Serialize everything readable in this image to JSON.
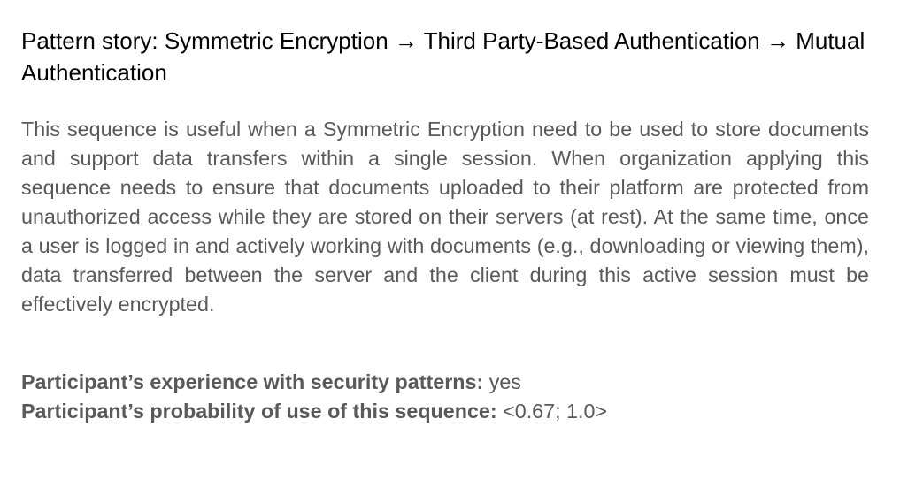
{
  "title": "Pattern story: Symmetric Encryption → Third Party-Based Authentication → Mutual Authentication",
  "paragraph": "This sequence is useful when a Symmetric Encryption need to be used to store documents and support data transfers within a single session. When organization applying this sequence needs to ensure that documents uploaded to their platform are protected from unauthorized access while they are stored on their servers (at rest). At the same time, once a user is logged in and actively working with documents (e.g., downloading or viewing them), data transferred between the server and the client during this active session must be effectively encrypted.",
  "experience": {
    "label": "Participant’s experience with security patterns:",
    "value": "yes"
  },
  "probability": {
    "label": "Participant’s probability of use of this sequence:",
    "value": "<0.67; 1.0>"
  }
}
